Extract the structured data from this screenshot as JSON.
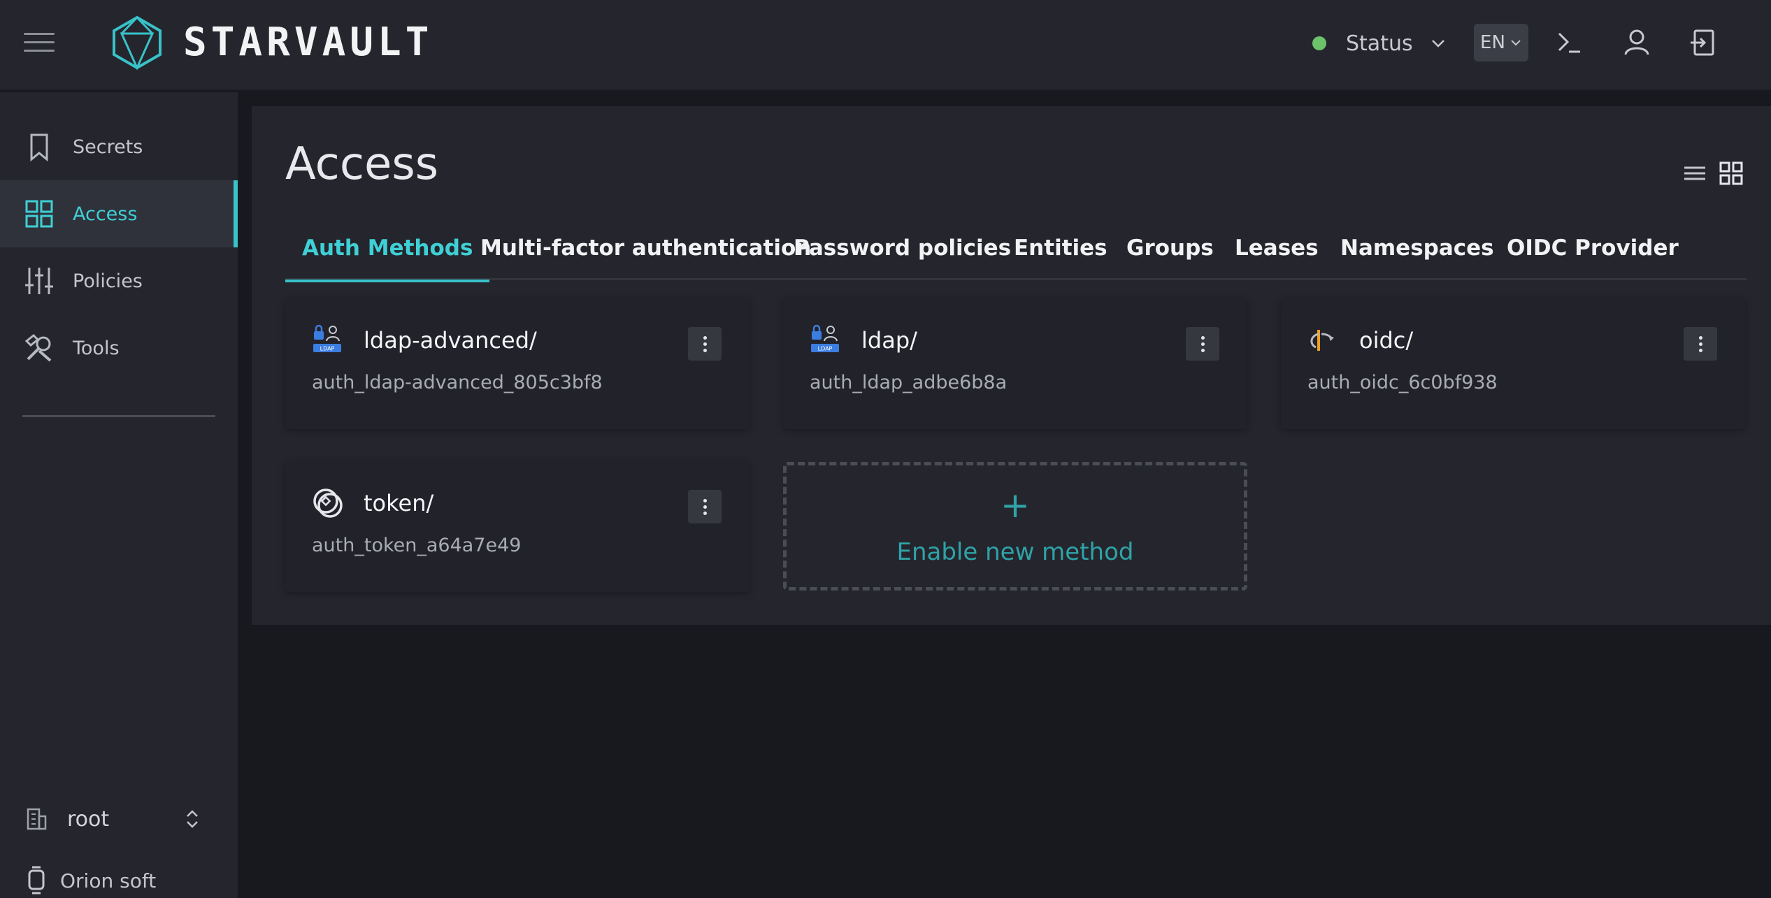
{
  "app": {
    "brand": "STARVAULT",
    "accent_color": "#39c2c9",
    "status_color": "#6cc36a"
  },
  "header": {
    "status_label": "Status",
    "language": "EN",
    "icons": [
      "menu-icon",
      "terminal-icon",
      "user-icon",
      "logout-icon"
    ]
  },
  "sidebar": {
    "items": [
      {
        "label": "Secrets",
        "icon": "bookmark-icon"
      },
      {
        "label": "Access",
        "icon": "grid-icon",
        "active": true
      },
      {
        "label": "Policies",
        "icon": "sliders-icon"
      },
      {
        "label": "Tools",
        "icon": "tools-icon"
      }
    ],
    "namespace": "root",
    "organization": "Orion soft"
  },
  "main": {
    "title": "Access",
    "tabs": [
      {
        "label": "Auth Methods",
        "active": true
      },
      {
        "label": "Multi-factor authentication"
      },
      {
        "label": "Password policies"
      },
      {
        "label": "Entities"
      },
      {
        "label": "Groups"
      },
      {
        "label": "Leases"
      },
      {
        "label": "Namespaces"
      },
      {
        "label": "OIDC Provider"
      }
    ],
    "cards": [
      {
        "title": "ldap-advanced/",
        "subtitle": "auth_ldap-advanced_805c3bf8",
        "icon": "ldap-icon"
      },
      {
        "title": "ldap/",
        "subtitle": "auth_ldap_adbe6b8a",
        "icon": "ldap-icon"
      },
      {
        "title": "oidc/",
        "subtitle": "auth_oidc_6c0bf938",
        "icon": "oidc-icon"
      },
      {
        "title": "token/",
        "subtitle": "auth_token_a64a7e49",
        "icon": "token-icon"
      }
    ],
    "enable_card": {
      "plus": "+",
      "label": "Enable new method"
    }
  }
}
